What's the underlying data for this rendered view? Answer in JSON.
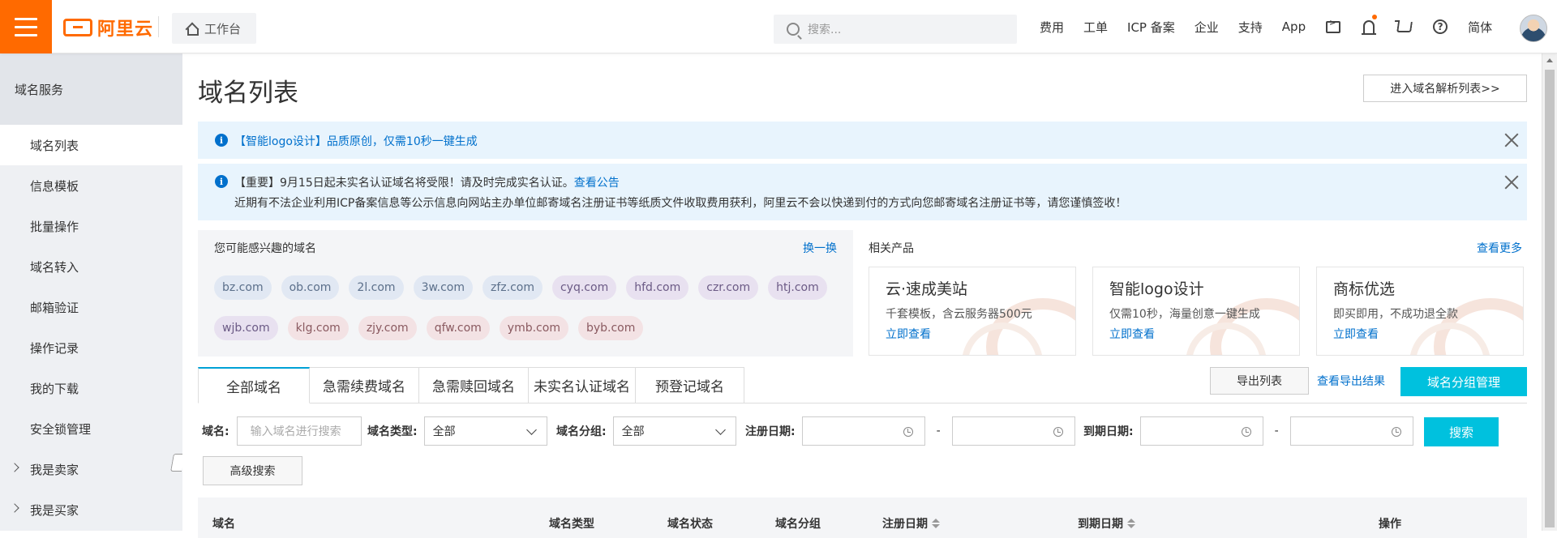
{
  "header": {
    "logo_text": "阿里云",
    "workbench": "工作台",
    "search_placeholder": "搜索...",
    "nav": [
      "费用",
      "工单",
      "ICP 备案",
      "企业",
      "支持",
      "App"
    ],
    "lang": "简体",
    "brand_color": "#ff6a00"
  },
  "sidebar": {
    "title": "域名服务",
    "items": [
      {
        "label": "域名列表",
        "active": true
      },
      {
        "label": "信息模板"
      },
      {
        "label": "批量操作"
      },
      {
        "label": "域名转入"
      },
      {
        "label": "邮箱验证"
      },
      {
        "label": "操作记录"
      },
      {
        "label": "我的下载"
      },
      {
        "label": "安全锁管理"
      },
      {
        "label": "我是卖家",
        "expandable": true
      },
      {
        "label": "我是买家",
        "expandable": true
      }
    ]
  },
  "main": {
    "title": "域名列表",
    "goto_dns_button": "进入域名解析列表>>",
    "notice1": "【智能logo设计】品质原创，仅需10秒一键生成",
    "notice2_line1": "【重要】9月15日起未实名认证域名将受限！请及时完成实名认证。",
    "notice2_link": "查看公告",
    "notice2_line2": "近期有不法企业利用ICP备案信息等公示信息向网站主办单位邮寄域名注册证书等纸质文件收取费用获利，阿里云不会以快递到付的方式向您邮寄域名注册证书等，请您谨慎签收！",
    "interest": {
      "title": "您可能感兴趣的域名",
      "swap": "换一换",
      "tags": [
        {
          "name": "bz.com",
          "tone": "blue"
        },
        {
          "name": "ob.com",
          "tone": "blue"
        },
        {
          "name": "2l.com",
          "tone": "blue"
        },
        {
          "name": "3w.com",
          "tone": "blue"
        },
        {
          "name": "zfz.com",
          "tone": "blue"
        },
        {
          "name": "cyq.com",
          "tone": "purple"
        },
        {
          "name": "hfd.com",
          "tone": "purple"
        },
        {
          "name": "czr.com",
          "tone": "purple"
        },
        {
          "name": "htj.com",
          "tone": "purple"
        },
        {
          "name": "wjb.com",
          "tone": "purple"
        },
        {
          "name": "klg.com",
          "tone": "red"
        },
        {
          "name": "zjy.com",
          "tone": "red"
        },
        {
          "name": "qfw.com",
          "tone": "red"
        },
        {
          "name": "ymb.com",
          "tone": "red"
        },
        {
          "name": "byb.com",
          "tone": "red"
        }
      ]
    },
    "related": {
      "title": "相关产品",
      "more": "查看更多",
      "products": [
        {
          "name": "云·速成美站",
          "desc": "千套模板，含云服务器500元",
          "link": "立即查看"
        },
        {
          "name": "智能logo设计",
          "desc": "仅需10秒，海量创意一键生成",
          "link": "立即查看"
        },
        {
          "name": "商标优选",
          "desc": "即买即用，不成功退全款",
          "link": "立即查看"
        }
      ]
    },
    "tabs": [
      "全部域名",
      "急需续费域名",
      "急需赎回域名",
      "未实名认证域名",
      "预登记域名"
    ],
    "export_button": "导出列表",
    "export_result": "查看导出结果",
    "group_button": "域名分组管理",
    "filters": {
      "domain_label": "域名:",
      "domain_placeholder": "输入域名进行搜索",
      "type_label": "域名类型:",
      "type_value": "全部",
      "group_label": "域名分组:",
      "group_value": "全部",
      "reg_label": "注册日期:",
      "exp_label": "到期日期:",
      "range_sep": "-",
      "search_button": "搜索",
      "advanced_button": "高级搜索"
    },
    "table_headers": [
      "域名",
      "域名类型",
      "域名状态",
      "域名分组",
      "注册日期",
      "到期日期",
      "操作"
    ]
  }
}
